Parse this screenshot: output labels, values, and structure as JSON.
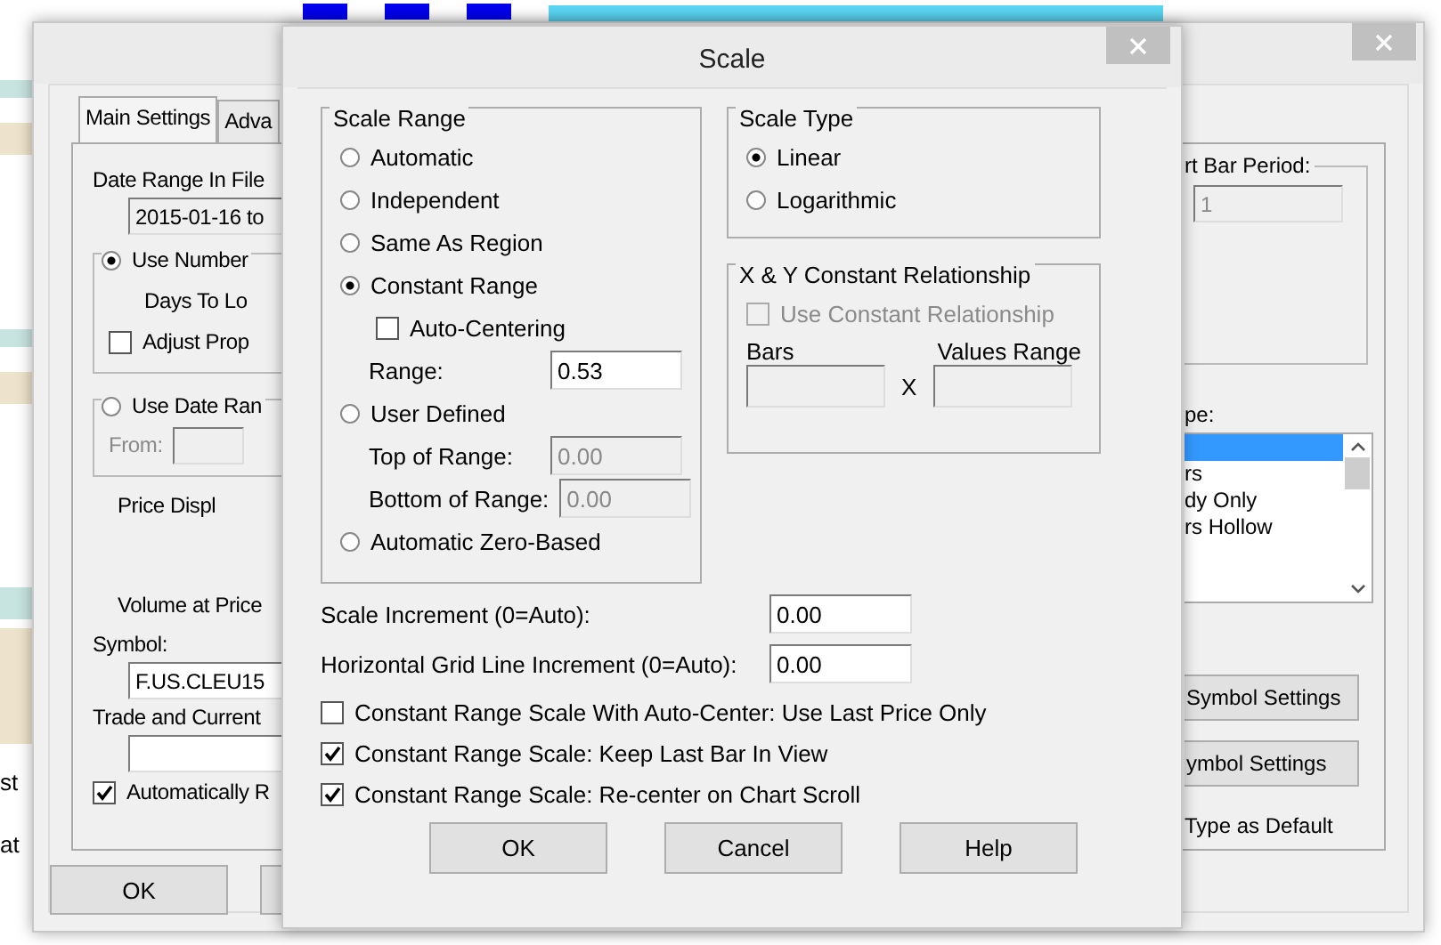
{
  "background_chart": {
    "left_labels": [
      "st",
      "at"
    ]
  },
  "settings_dialog": {
    "tabs": [
      {
        "label": "Main Settings",
        "selected": true
      },
      {
        "label": "Adva",
        "selected": false
      }
    ],
    "left": [
      {
        "kind": "label",
        "text": "Date Range In File"
      },
      {
        "kind": "field",
        "value": "2015-01-16 to",
        "disabled": true
      },
      {
        "kind": "group",
        "radio": {
          "text": "Use Number",
          "selected": true
        },
        "items": [
          {
            "kind": "center",
            "text": "Days To Lo"
          },
          {
            "kind": "check",
            "text": "Adjust Prop",
            "checked": false
          }
        ]
      },
      {
        "kind": "group",
        "radio": {
          "text": "Use Date Ran",
          "selected": false
        },
        "items": [
          {
            "kind": "labeled_field",
            "text": "From:",
            "disabled": true
          }
        ]
      },
      {
        "kind": "center",
        "text": "Price Displ"
      },
      {
        "kind": "spacer"
      },
      {
        "kind": "center",
        "text": "Volume at Price"
      },
      {
        "kind": "label",
        "text": "Symbol:"
      },
      {
        "kind": "field",
        "value": "F.US.CLEU15",
        "disabled": false
      },
      {
        "kind": "label",
        "text": "Trade and Current"
      },
      {
        "kind": "field",
        "disabled": false
      },
      {
        "kind": "check",
        "text": "Automatically R",
        "checked": true
      }
    ],
    "ok_button": "OK",
    "bar_period": {
      "legend": "rt Bar Period:",
      "value": "1"
    },
    "type_label": "pe:",
    "type_list": [
      {
        "selected": true
      },
      {
        "text": "rs",
        "selected": false
      },
      {
        "text": "dy Only",
        "selected": false
      },
      {
        "text": "rs Hollow",
        "selected": false
      }
    ],
    "buttons": [
      "Symbol Settings",
      "ymbol Settings"
    ],
    "default_text": "Type as Default"
  },
  "scale_dialog": {
    "title": "Scale",
    "scale_range": {
      "legend": "Scale Range",
      "items": [
        {
          "kind": "radio",
          "text": "Automatic",
          "selected": false
        },
        {
          "kind": "radio",
          "text": "Independent",
          "selected": false
        },
        {
          "kind": "radio",
          "text": "Same As Region",
          "selected": false
        },
        {
          "kind": "radio",
          "text": "Constant Range",
          "selected": true
        },
        {
          "kind": "check",
          "text": "Auto-Centering",
          "checked": false
        },
        {
          "kind": "field",
          "text": "Range:",
          "value": "0.53",
          "disabled": false
        },
        {
          "kind": "radio",
          "text": "User Defined",
          "selected": false
        },
        {
          "kind": "field",
          "text": "Top of Range:",
          "value": "0.00",
          "disabled": true
        },
        {
          "kind": "field",
          "text": "Bottom of Range:",
          "value": "0.00",
          "disabled": true
        },
        {
          "kind": "radio",
          "text": "Automatic Zero-Based",
          "selected": false
        }
      ]
    },
    "scale_type": {
      "legend": "Scale Type",
      "options": [
        {
          "text": "Linear",
          "selected": true
        },
        {
          "text": "Logarithmic",
          "selected": false
        }
      ]
    },
    "xy": {
      "legend": "X & Y Constant Relationship",
      "checkbox": {
        "text": "Use Constant Relationship",
        "checked": false,
        "disabled": true
      },
      "bars_label": "Bars",
      "x_label": "X",
      "values_label": "Values Range"
    },
    "increments": [
      {
        "label": "Scale Increment (0=Auto):",
        "value": "0.00"
      },
      {
        "label": "Horizontal Grid Line Increment (0=Auto):",
        "value": "0.00"
      }
    ],
    "options": [
      {
        "text": "Constant Range Scale With Auto-Center: Use Last Price Only",
        "checked": false
      },
      {
        "text": "Constant Range Scale: Keep Last Bar In View",
        "checked": true
      },
      {
        "text": "Constant Range Scale: Re-center on Chart Scroll",
        "checked": true
      }
    ],
    "buttons": [
      "OK",
      "Cancel",
      "Help"
    ]
  }
}
